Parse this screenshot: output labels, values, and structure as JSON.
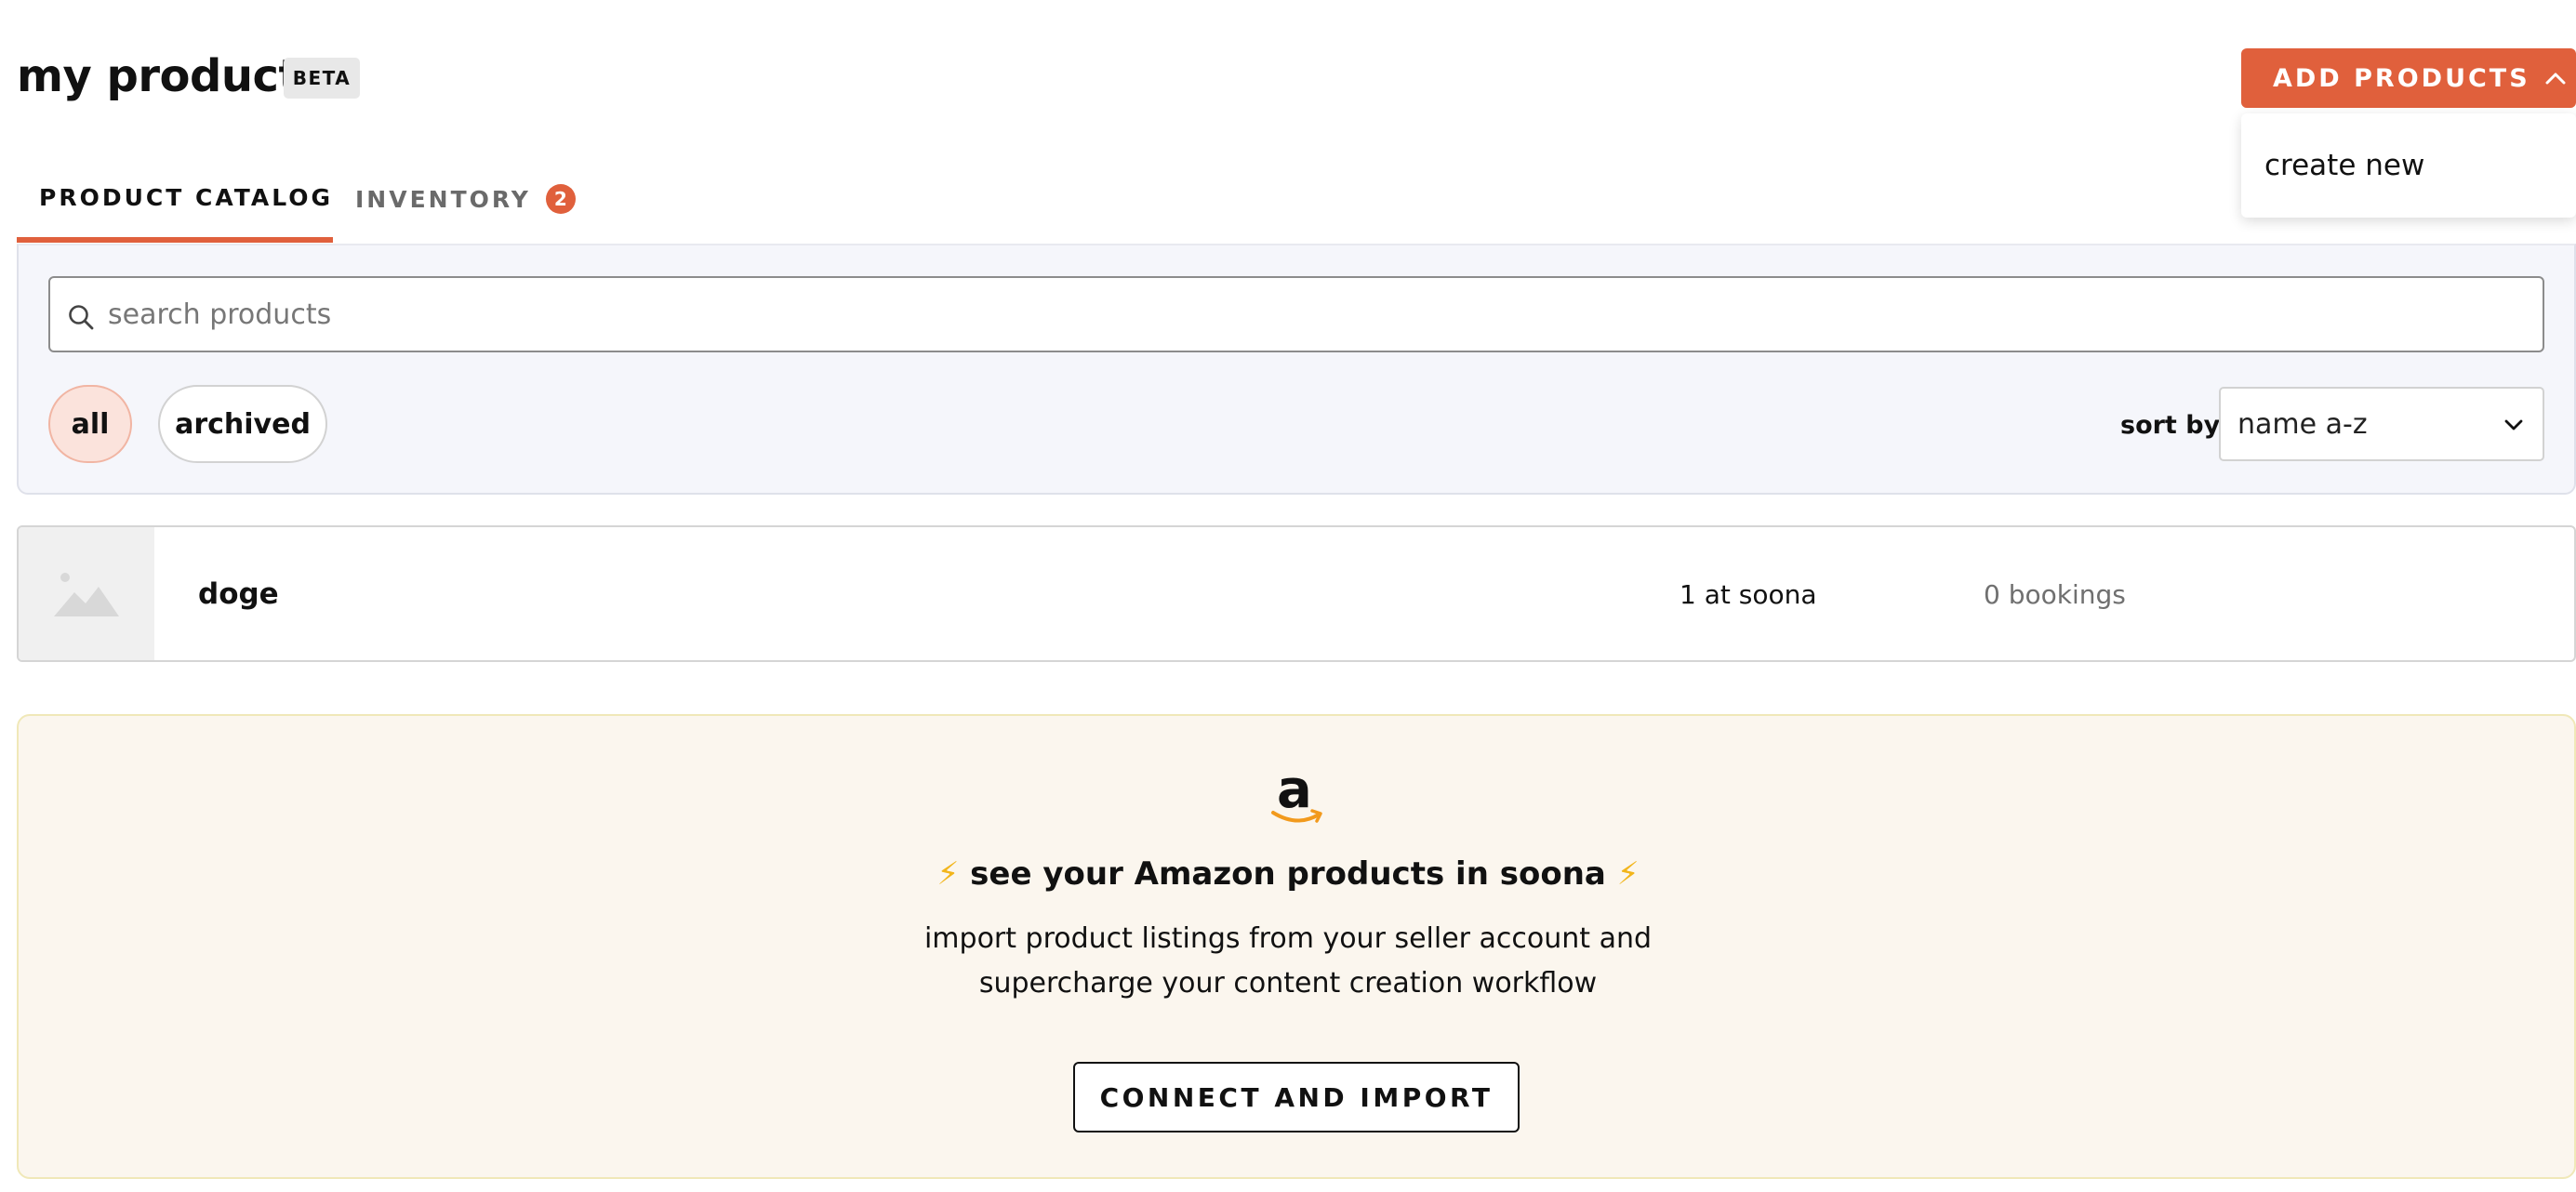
{
  "header": {
    "title": "my products",
    "badge": "BETA",
    "add_button_label": "ADD PRODUCTS",
    "dropdown_items": [
      {
        "label": "create new"
      }
    ]
  },
  "tabs": [
    {
      "label": "PRODUCT CATALOG",
      "active": true
    },
    {
      "label": "INVENTORY",
      "count": "2",
      "active": false
    }
  ],
  "filters": {
    "search_placeholder": "search products",
    "search_value": "",
    "chips": [
      {
        "label": "all",
        "selected": true
      },
      {
        "label": "archived",
        "selected": false
      }
    ],
    "sort_label": "sort by",
    "sort_value": "name a-z"
  },
  "products": [
    {
      "name": "doge",
      "location": "1 at soona",
      "bookings": "0 bookings"
    }
  ],
  "amazon_banner": {
    "title": "see your Amazon products in soona",
    "bolt_glyph": "⚡",
    "description_line1": "import product listings from your seller account and",
    "description_line2": "supercharge your content creation workflow",
    "button_label": "CONNECT AND IMPORT"
  },
  "colors": {
    "accent": "#e0603c",
    "chip_selected_bg": "#fbe3dc",
    "banner_bg": "#fbf6ee",
    "filter_panel_bg": "#f5f6fb",
    "bolt": "#f2b51b"
  }
}
